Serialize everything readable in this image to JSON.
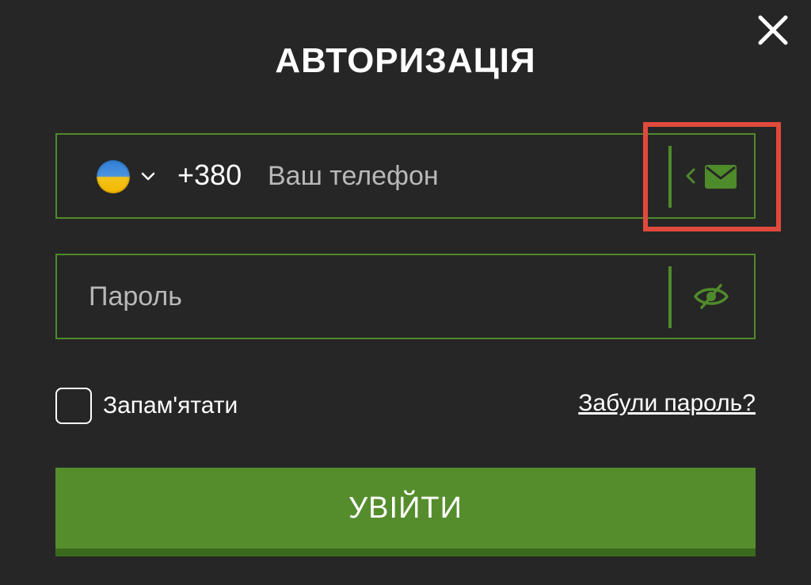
{
  "title": "АВТОРИЗАЦІЯ",
  "phone_field": {
    "country_icon": "ukraine-flag-icon",
    "prefix": "+380",
    "placeholder": "Ваш телефон",
    "value": "",
    "switch_icon": "envelope-icon"
  },
  "password_field": {
    "placeholder": "Пароль",
    "value": "",
    "toggle_icon": "eye-slash-icon"
  },
  "remember_label": "Запам'ятати",
  "forgot_link": "Забули пароль?",
  "submit_label": "УВІЙТИ",
  "colors": {
    "background": "#262626",
    "accent": "#558d2d",
    "accent_border": "#4f8a2b",
    "highlight": "#e04a3c",
    "text": "#ffffff",
    "placeholder": "#b8b8b8"
  }
}
